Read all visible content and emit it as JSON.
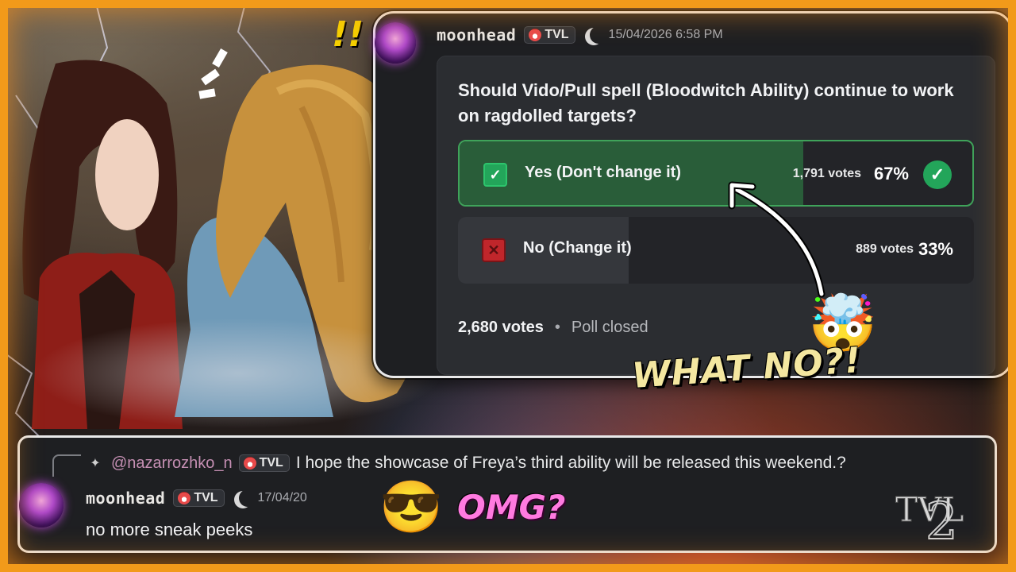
{
  "poll": {
    "author": {
      "username": "moonhead",
      "tag": "TVL",
      "timestamp": "15/04/2026 6:58 PM"
    },
    "question": "Should Vido/Pull spell (Bloodwitch Ability) continue to work on ragdolled targets?",
    "answers": [
      {
        "label": "Yes (Don't change it)",
        "votes": "1,791 votes",
        "percent": "67%",
        "fraction": 0.67,
        "selected": true
      },
      {
        "label": "No (Change it)",
        "votes": "889 votes",
        "percent": "33%",
        "fraction": 0.33,
        "selected": false
      }
    ],
    "total_votes": "2,680 votes",
    "separator": "•",
    "status": "Poll closed"
  },
  "overlay": {
    "exclaim": "!!",
    "reaction_text": "WHAT NO?!",
    "reaction_emoji": "🤯",
    "omg_text": "OMG?",
    "omg_emoji": "😎"
  },
  "reply": {
    "replied_to": {
      "mention": "@nazarrozhko_n",
      "tag": "TVL",
      "text": "I hope the showcase of Freya’s third ability will be released this weekend.?"
    },
    "author": {
      "username": "moonhead",
      "tag": "TVL",
      "timestamp": "17/04/20"
    },
    "message": "no more sneak peeks"
  },
  "colors": {
    "frame": "#f29a1a",
    "card_bg": "#1e1f22",
    "poll_inner": "#2b2d31",
    "yes_fill": "#295d39",
    "yes_border": "#3fa35a",
    "green_check": "#23a55a",
    "no_fill": "#35373c",
    "mention": "#c58fb3"
  },
  "icons": [
    "checkbox-check-icon",
    "checkbox-cross-icon",
    "selected-check-icon",
    "tag-badge-icon",
    "moon-icon"
  ]
}
